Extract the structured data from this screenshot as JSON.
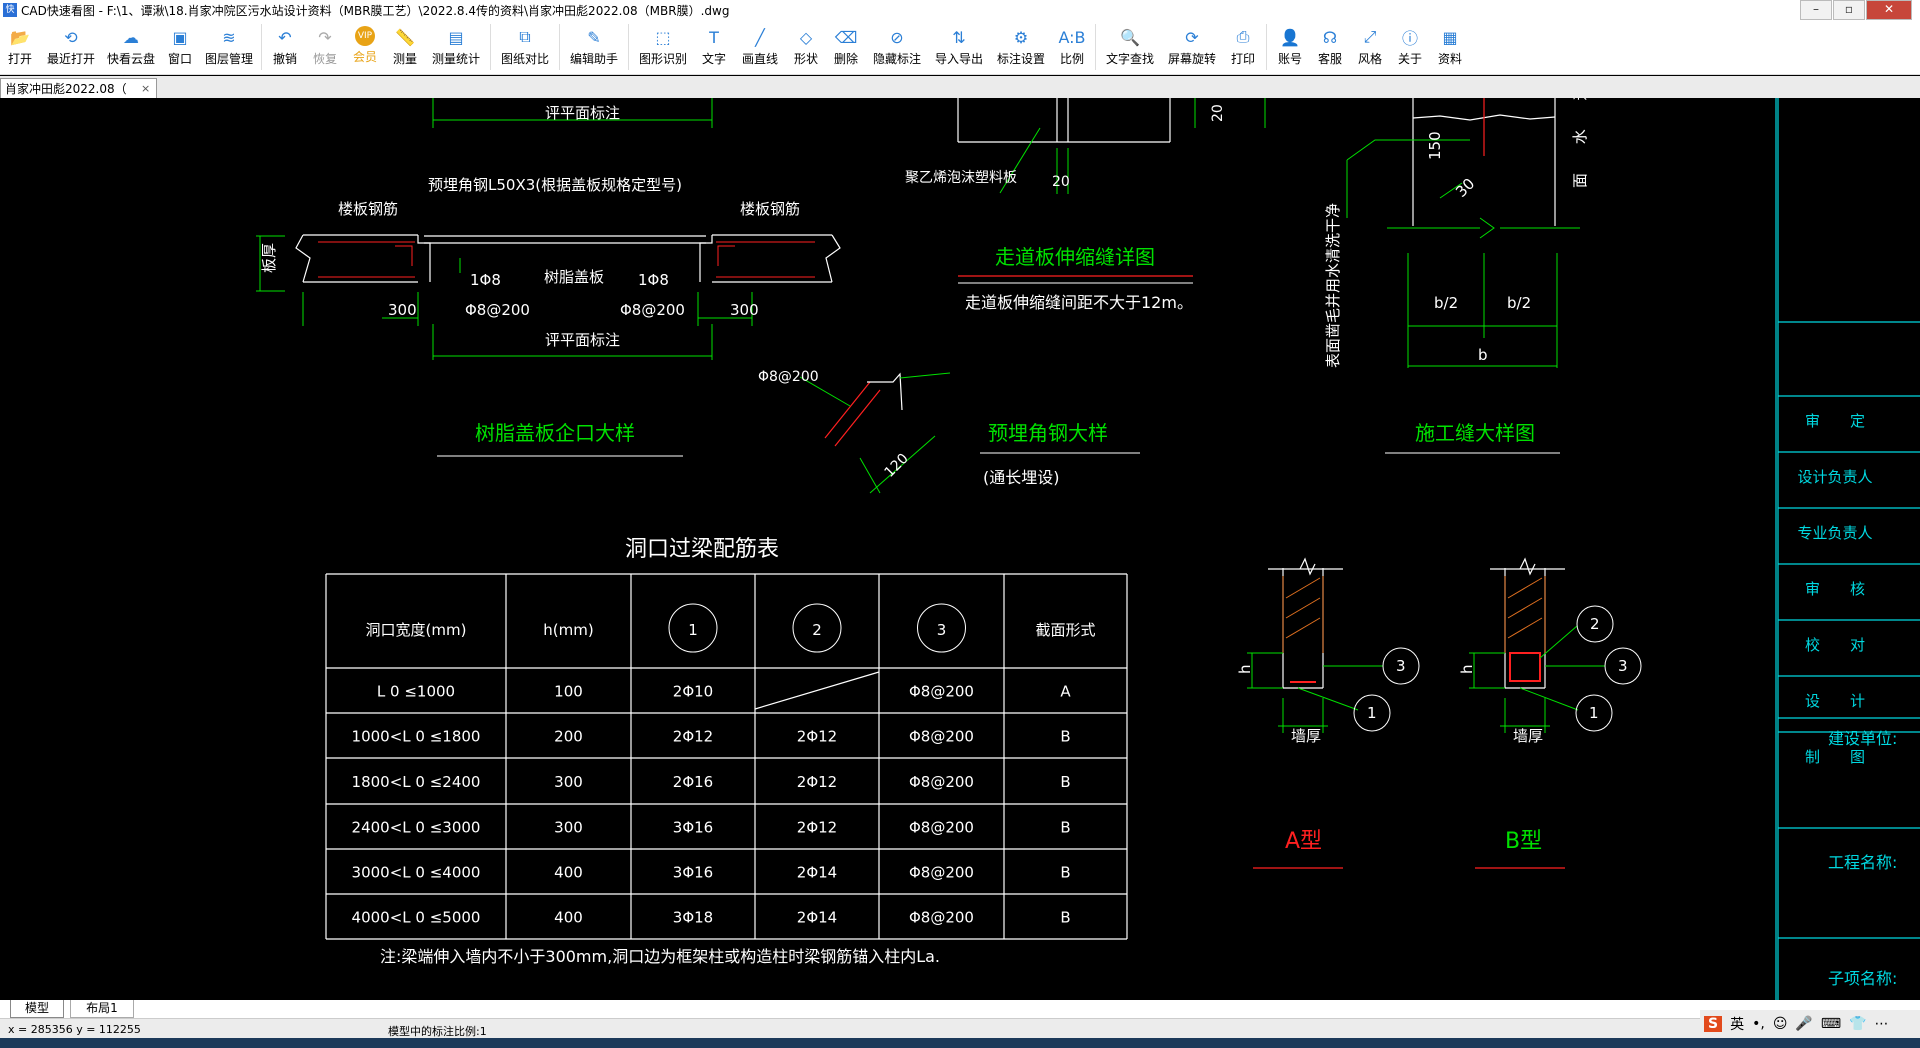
{
  "window": {
    "title": "CAD快速看图 - F:\\1、谭湫\\18.肖家冲院区污水站设计资料（MBR膜工艺）\\2022.8.4传的资料\\肖家冲田彪2022.08（MBR膜）.dwg",
    "app_icon": "快图"
  },
  "toolbar": [
    {
      "label": "打开",
      "icon": "folder-open-icon",
      "glyph": "📂"
    },
    {
      "label": "最近打开",
      "icon": "history-icon",
      "glyph": "⟲"
    },
    {
      "label": "快看云盘",
      "icon": "cloud-icon",
      "glyph": "☁"
    },
    {
      "label": "窗口",
      "icon": "window-icon",
      "glyph": "▣"
    },
    {
      "label": "图层管理",
      "icon": "layers-icon",
      "glyph": "≋"
    },
    {
      "label": "撤销",
      "icon": "undo-icon",
      "glyph": "↶"
    },
    {
      "label": "恢复",
      "icon": "redo-icon",
      "glyph": "↷"
    },
    {
      "label": "会员",
      "icon": "vip-icon",
      "glyph": "VIP"
    },
    {
      "label": "测量",
      "icon": "measure-icon",
      "glyph": "📏"
    },
    {
      "label": "测量统计",
      "icon": "measure-stats-icon",
      "glyph": "▤"
    },
    {
      "label": "图纸对比",
      "icon": "compare-icon",
      "glyph": "⧉"
    },
    {
      "label": "编辑助手",
      "icon": "edit-helper-icon",
      "glyph": "✎"
    },
    {
      "label": "图形识别",
      "icon": "shape-recognize-icon",
      "glyph": "⬚"
    },
    {
      "label": "文字",
      "icon": "text-icon",
      "glyph": "T"
    },
    {
      "label": "画直线",
      "icon": "line-icon",
      "glyph": "╱"
    },
    {
      "label": "形状",
      "icon": "shape-icon",
      "glyph": "◇"
    },
    {
      "label": "删除",
      "icon": "eraser-icon",
      "glyph": "⌫"
    },
    {
      "label": "隐藏标注",
      "icon": "hide-annotation-icon",
      "glyph": "⊘"
    },
    {
      "label": "导入导出",
      "icon": "import-export-icon",
      "glyph": "⇅"
    },
    {
      "label": "标注设置",
      "icon": "annotation-settings-icon",
      "glyph": "⚙"
    },
    {
      "label": "比例",
      "icon": "scale-icon",
      "glyph": "A:B"
    },
    {
      "label": "文字查找",
      "icon": "text-search-icon",
      "glyph": "🔍"
    },
    {
      "label": "屏幕旋转",
      "icon": "rotate-screen-icon",
      "glyph": "⟳"
    },
    {
      "label": "打印",
      "icon": "print-icon",
      "glyph": "⎙"
    },
    {
      "label": "账号",
      "icon": "account-icon",
      "glyph": "👤"
    },
    {
      "label": "客服",
      "icon": "headset-icon",
      "glyph": "☊"
    },
    {
      "label": "风格",
      "icon": "style-icon",
      "glyph": "⤢"
    },
    {
      "label": "关于",
      "icon": "info-icon",
      "glyph": "ⓘ"
    },
    {
      "label": "资料",
      "icon": "docs-icon",
      "glyph": "▦"
    }
  ],
  "doc_tab": {
    "label": "肖家冲田彪2022.08（",
    "close": "×"
  },
  "drawing": {
    "d1": {
      "title": "树脂盖板企口大样",
      "top_dim": "评平面标注",
      "bottom_dim": "评平面标注",
      "angle_label": "预埋角钢L50X3(根据盖板规格定型号)",
      "rebar_left": "楼板钢筋",
      "rebar_right": "楼板钢筋",
      "cover": "树脂盖板",
      "thickness": "板厚",
      "bar1": "1Φ8",
      "bar2": "1Φ8",
      "stirrup1": "Φ8@200",
      "stirrup2": "Φ8@200",
      "dim_l": "300",
      "dim_r": "300"
    },
    "d2": {
      "title": "走道板伸缩缝详图",
      "note": "走道板伸缩缝间距不大于12m。",
      "foam": "聚乙烯泡沫塑料板",
      "dim20": "20",
      "dim20b": "20"
    },
    "d3": {
      "title": "预埋角钢大样",
      "subtitle": "(通长埋设)",
      "bar": "Φ8@200",
      "dim": "120"
    },
    "d4": {
      "title": "施工缝大样图",
      "note": "表面凿毛并用水清洗干净",
      "dim150": "150",
      "dim30": "30",
      "half1": "b/2",
      "half2": "b/2",
      "b": "b",
      "water": "面 水 迎"
    },
    "table": {
      "title": "洞口过梁配筋表",
      "headers": [
        "洞口宽度(mm)",
        "h(mm)",
        "1",
        "2",
        "3",
        "截面形式"
      ],
      "rows": [
        [
          "L 0  ≤1000",
          "100",
          "2Φ10",
          "",
          "Φ8@200",
          "A"
        ],
        [
          "1000<L 0  ≤1800",
          "200",
          "2Φ12",
          "2Φ12",
          "Φ8@200",
          "B"
        ],
        [
          "1800<L 0  ≤2400",
          "300",
          "2Φ16",
          "2Φ12",
          "Φ8@200",
          "B"
        ],
        [
          "2400<L 0  ≤3000",
          "300",
          "3Φ16",
          "2Φ12",
          "Φ8@200",
          "B"
        ],
        [
          "3000<L 0  ≤4000",
          "400",
          "3Φ16",
          "2Φ14",
          "Φ8@200",
          "B"
        ],
        [
          "4000<L 0  ≤5000",
          "400",
          "3Φ18",
          "2Φ14",
          "Φ8@200",
          "B"
        ]
      ],
      "note": "注:梁端伸入墙内不小于300mm,洞口边为框架柱或构造柱时梁钢筋锚入柱内La."
    },
    "typeA": {
      "title": "A型",
      "h": "h",
      "wall": "墙厚",
      "c1": "1",
      "c3": "3"
    },
    "typeB": {
      "title": "B型",
      "h": "h",
      "wall": "墙厚",
      "c1": "1",
      "c2": "2",
      "c3": "3"
    },
    "titleblock": {
      "rows": [
        "审　　定",
        "设计负责人",
        "专业负责人",
        "审　　核",
        "校　　对",
        "设　　计",
        "制　　图"
      ],
      "client": "建设单位:",
      "project": "工程名称:",
      "subitem": "子项名称:"
    }
  },
  "layout_tabs": [
    "模型",
    "布局1"
  ],
  "status": {
    "coords": "x = 285356  y = 112255",
    "scale": "模型中的标注比例:1"
  },
  "tray": {
    "ime": "S",
    "icons": [
      "英",
      "•,",
      "☺",
      "🎤",
      "⌨",
      "👕",
      "⋯"
    ]
  },
  "colors": {
    "green": "#00e000",
    "white": "#ffffff",
    "red": "#ff2020",
    "cyan": "#00d8e0",
    "orange": "#e07020"
  }
}
